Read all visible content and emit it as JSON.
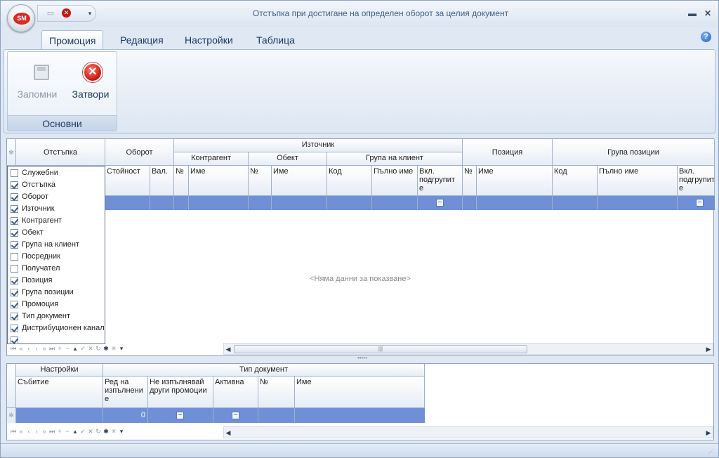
{
  "window": {
    "title": "Отстъпка  при достигане на определен оборот за целия документ",
    "logo": "SM",
    "controls": [
      "minimize-icon",
      "close-icon"
    ]
  },
  "qat": {
    "icons": [
      "save-icon",
      "close-icon",
      "dropdown-icon"
    ]
  },
  "ribbon": {
    "tabs": [
      "Промоция",
      "Редакция",
      "Настройки",
      "Таблица"
    ],
    "active_tab": "Промоция",
    "group_caption": "Основни",
    "buttons": [
      {
        "label": "Запомни",
        "icon": "save-icon",
        "enabled": false
      },
      {
        "label": "Затвори",
        "icon": "close-icon",
        "enabled": true
      }
    ]
  },
  "top_grid": {
    "bands": {
      "discount": "Отстъпка",
      "turnover": "Оборот",
      "source": "Източник",
      "counterparty": "Контрагент",
      "object": "Обект",
      "client_group": "Група на клиент",
      "position": "Позиция",
      "position_group": "Група позиции"
    },
    "columns": {
      "value": "Стойност",
      "currency": "Вал.",
      "cp_no": "№",
      "cp_name": "Име",
      "obj_no": "№",
      "obj_name": "Име",
      "cg_code": "Код",
      "cg_fullname": "Пълно име",
      "cg_subgroups": "Вкл. подгрупит е",
      "pos_no": "№",
      "pos_name": "Име",
      "pg_code": "Код",
      "pg_fullname": "Пълно име",
      "pg_subgroups": "Вкл. подгрупит е"
    },
    "no_data": "<Няма данни за показване>",
    "column_chooser": [
      {
        "label": "Служебни",
        "checked": false
      },
      {
        "label": "Отстъпка",
        "checked": true
      },
      {
        "label": "Оборот",
        "checked": true
      },
      {
        "label": "Източник",
        "checked": true
      },
      {
        "label": "Контрагент",
        "checked": true
      },
      {
        "label": "Обект",
        "checked": true
      },
      {
        "label": "Група на клиент",
        "checked": true
      },
      {
        "label": "Посредник",
        "checked": false
      },
      {
        "label": "Получател",
        "checked": false
      },
      {
        "label": "Позиция",
        "checked": true
      },
      {
        "label": "Група позиции",
        "checked": true
      },
      {
        "label": "Промоция",
        "checked": true
      },
      {
        "label": "Тип документ",
        "checked": true
      },
      {
        "label": "Дистрибуционен канал",
        "checked": true
      },
      {
        "label": "",
        "checked": true
      }
    ]
  },
  "bottom_grid": {
    "bands": {
      "settings": "Настройки",
      "doc_type": "Тип документ"
    },
    "columns": {
      "event": "Събитие",
      "exec_order": "Ред на изпълнени е",
      "no_other": "Не изпълнявай други промоции",
      "active": "Активна",
      "no": "№",
      "name": "Име"
    },
    "row": {
      "exec_order": "0"
    }
  },
  "navigator_icons": [
    "first-icon",
    "prev-page-icon",
    "prev-icon",
    "next-icon",
    "next-page-icon",
    "last-icon",
    "append-icon",
    "delete-icon",
    "edit-icon",
    "post-icon",
    "cancel-icon",
    "refresh-icon",
    "bookmark-icon",
    "goto-bookmark-icon",
    "filter-icon"
  ],
  "colors": {
    "accent": "#6f8fd6",
    "title": "#3e5f8a",
    "ribbon_text": "#1f3b61"
  }
}
